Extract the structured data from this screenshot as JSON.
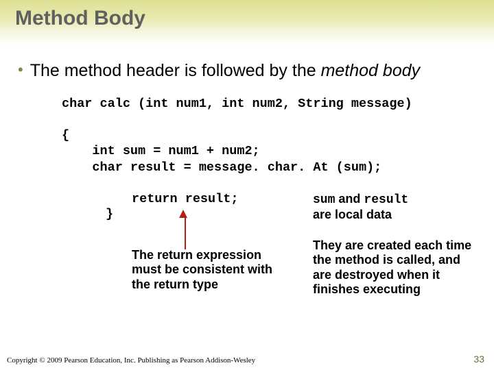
{
  "title": "Method Body",
  "bullet": {
    "part1": "The method header is followed by the ",
    "italic": "method body"
  },
  "code": {
    "sig": "char calc (int num1, int num2, String message)",
    "open": "{",
    "l1": "    int sum = num1 + num2;",
    "l2": "    char result = message. char. At (sum);",
    "ret": "return result;",
    "close": "}"
  },
  "notes": {
    "left": "The return expression must be consistent with the return type",
    "right1": {
      "sum": "sum",
      "and": " and ",
      "result": "result",
      "rest": "are local data"
    },
    "right2": "They are created each time the method is called, and are destroyed when it finishes executing"
  },
  "footer": "Copyright © 2009 Pearson Education, Inc. Publishing as Pearson Addison-Wesley",
  "page": "33"
}
